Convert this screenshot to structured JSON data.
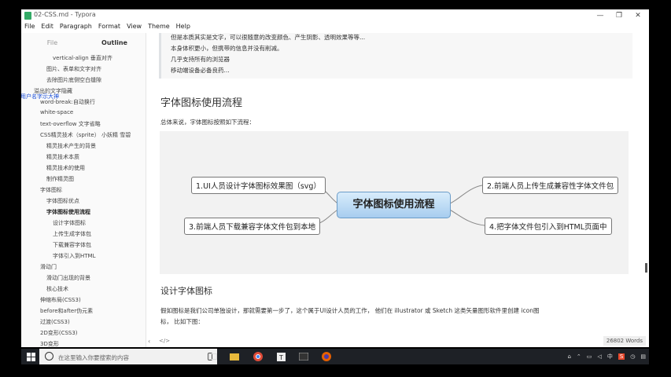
{
  "window": {
    "title": "02-CSS.md - Typora",
    "buttons": [
      "—",
      "❐",
      "✕"
    ]
  },
  "menu": [
    "File",
    "Edit",
    "Paragraph",
    "Format",
    "View",
    "Theme",
    "Help"
  ],
  "sidebar": {
    "tabs": [
      "File",
      "Outline"
    ],
    "overlay_text": "用户名字示大神",
    "items": [
      {
        "label": "vertical-align 垂直对齐"
      },
      {
        "label": "图片、表单和文字对齐"
      },
      {
        "label": "去除图片底侧空白缝隙"
      },
      {
        "label": "溢出的文字隐藏"
      },
      {
        "label": "word-break:自动换行"
      },
      {
        "label": "white-space"
      },
      {
        "label": "text-overflow 文字省略"
      },
      {
        "label": "CSS精灵技术（sprite） 小妖精 雪碧"
      },
      {
        "label": "精灵技术产生的背景"
      },
      {
        "label": "精灵技术本质"
      },
      {
        "label": "精灵技术的使用"
      },
      {
        "label": "制作精灵图"
      },
      {
        "label": "字体图标"
      },
      {
        "label": "字体图标优点"
      },
      {
        "label": "字体图标使用流程"
      },
      {
        "label": "设计字体图标"
      },
      {
        "label": "上传生成字体包"
      },
      {
        "label": "下载兼容字体包"
      },
      {
        "label": "字体引入到HTML"
      },
      {
        "label": "滑动门"
      },
      {
        "label": "滑动门出现的背景"
      },
      {
        "label": "核心技术"
      },
      {
        "label": "伸缩布局(CSS3)"
      },
      {
        "label": "before和after伪元素"
      },
      {
        "label": "过渡(CSS3)"
      },
      {
        "label": "2D变形(CSS3)"
      },
      {
        "label": "3D变形"
      }
    ]
  },
  "content": {
    "quote_lines": [
      "但是本质其实是文字，可以很随意的改变颜色、产生阴影、透明效果等等...",
      "本身体积更小，但携带的信息并没有削减。",
      "几乎支持所有的浏览器",
      "移动端设备必备良药..."
    ],
    "heading1": "字体图标使用流程",
    "intro": "总体来说，字体图标按照如下流程：",
    "mindmap": {
      "center": "字体图标使用流程",
      "nodes": [
        "1.UI人员设计字体图标效果图（svg）",
        "2.前端人员上传生成兼容性字体文件包",
        "3.前端人员下载兼容字体文件包到本地",
        "4.把字体文件包引入到HTML页面中"
      ]
    },
    "heading2": "设计字体图标",
    "para_line1": "假如图标是我们公司单独设计，那就需要第一步了，这个属于UI设计人员的工作， 他们在 illustrator 或 Sketch 这类矢量图形软件里创建 icon图",
    "para_line2": "标， 比如下图："
  },
  "status": {
    "words": "26802 Words",
    "source_toggle": "</>"
  },
  "taskbar": {
    "search_placeholder": "在这里输入你要搜索的内容",
    "ime": "中",
    "tray_s": "S"
  },
  "colors": {
    "accent_blue": "#1a4ed8",
    "center_node_top": "#d8ecfb",
    "center_node_bottom": "#a7cdef",
    "taskbar": "#1e2126"
  }
}
